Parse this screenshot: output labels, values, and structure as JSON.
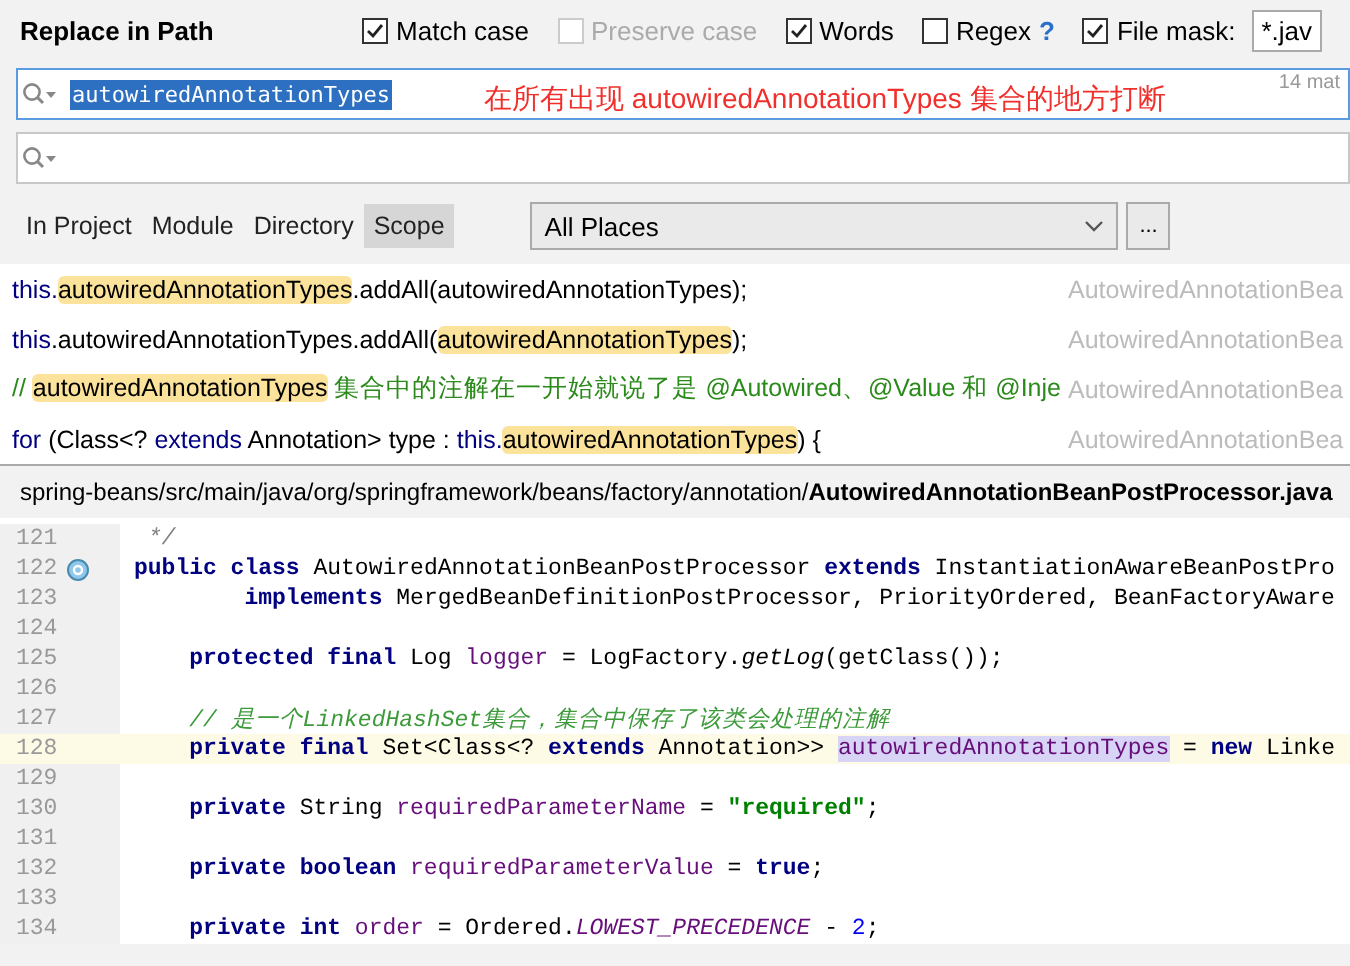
{
  "window": {
    "title": "Replace in Path"
  },
  "options": [
    {
      "label": "Match case",
      "checked": true,
      "disabled": false
    },
    {
      "label": "Preserve case",
      "checked": false,
      "disabled": true
    },
    {
      "label": "Words",
      "checked": true,
      "disabled": false
    },
    {
      "label": "Regex",
      "checked": false,
      "disabled": false,
      "help": "?"
    },
    {
      "label": "File mask:",
      "checked": true,
      "disabled": false,
      "field_value": "*.jav"
    }
  ],
  "search": {
    "value": "autowiredAnnotationTypes",
    "count": "14 mat"
  },
  "annotation": "在所有出现 autowiredAnnotationTypes 集合的地方打断",
  "scope_tabs": [
    {
      "label": "In Project",
      "selected": false
    },
    {
      "label": "Module",
      "selected": false
    },
    {
      "label": "Directory",
      "selected": false
    },
    {
      "label": "Scope",
      "selected": true
    }
  ],
  "scope_dropdown": {
    "value": "All Places"
  },
  "more_button": "...",
  "results": [
    {
      "segments": [
        {
          "kind": "kw",
          "text": "this."
        },
        {
          "kind": "match",
          "text": "autowiredAnnotationTypes"
        },
        {
          "kind": "plain",
          "text": ".addAll(autowiredAnnotationTypes);"
        }
      ],
      "file": "AutowiredAnnotationBea"
    },
    {
      "segments": [
        {
          "kind": "kw",
          "text": "this"
        },
        {
          "kind": "plain",
          "text": ".autowiredAnnotationTypes.addAll("
        },
        {
          "kind": "match",
          "text": "autowiredAnnotationTypes"
        },
        {
          "kind": "plain",
          "text": ");"
        }
      ],
      "file": "AutowiredAnnotationBea"
    },
    {
      "segments": [
        {
          "kind": "comment",
          "text": "// "
        },
        {
          "kind": "match",
          "text": "autowiredAnnotationTypes"
        },
        {
          "kind": "comment",
          "text": " 集合中的注解在一开始就说了是 @Autowired、@Value 和 @Inje"
        }
      ],
      "file": "AutowiredAnnotationBea"
    },
    {
      "segments": [
        {
          "kind": "kw",
          "text": "for"
        },
        {
          "kind": "plain",
          "text": " (Class<? "
        },
        {
          "kind": "kw",
          "text": "extends"
        },
        {
          "kind": "plain",
          "text": " Annotation> type : "
        },
        {
          "kind": "kw",
          "text": "this."
        },
        {
          "kind": "match",
          "text": "autowiredAnnotationTypes"
        },
        {
          "kind": "plain",
          "text": ") {"
        }
      ],
      "file": "AutowiredAnnotationBea"
    }
  ],
  "path": {
    "dir": "spring-beans/src/main/java/org/springframework/beans/factory/annotation/",
    "file": "AutowiredAnnotationBeanPostProcessor.java"
  },
  "code_lines": [
    {
      "number": "121",
      "current": false,
      "marker": false,
      "segments": [
        {
          "kind": "doc",
          "text": " */"
        }
      ]
    },
    {
      "number": "122",
      "current": false,
      "marker": true,
      "segments": [
        {
          "kind": "kw",
          "text": "public class"
        },
        {
          "kind": "plain",
          "text": " AutowiredAnnotationBeanPostProcessor "
        },
        {
          "kind": "kw",
          "text": "extends"
        },
        {
          "kind": "plain",
          "text": " InstantiationAwareBeanPostPro"
        }
      ]
    },
    {
      "number": "123",
      "current": false,
      "marker": false,
      "segments": [
        {
          "kind": "kw",
          "text": "        implements"
        },
        {
          "kind": "plain",
          "text": " MergedBeanDefinitionPostProcessor, PriorityOrdered, BeanFactoryAware"
        }
      ]
    },
    {
      "number": "124",
      "current": false,
      "marker": false
    },
    {
      "number": "125",
      "current": false,
      "marker": false,
      "segments": [
        {
          "kind": "kw",
          "text": "    protected final"
        },
        {
          "kind": "plain",
          "text": " Log "
        },
        {
          "kind": "field",
          "text": "logger"
        },
        {
          "kind": "plain",
          "text": " = LogFactory."
        },
        {
          "kind": "italic",
          "text": "getLog"
        },
        {
          "kind": "plain",
          "text": "(getClass());"
        }
      ]
    },
    {
      "number": "126",
      "current": false,
      "marker": false
    },
    {
      "number": "127",
      "current": false,
      "marker": false,
      "segments": [
        {
          "kind": "comment",
          "text": "    // 是一个LinkedHashSet集合，集合中保存了该类会处理的注解"
        }
      ]
    },
    {
      "number": "128",
      "current": true,
      "marker": false,
      "segments": [
        {
          "kind": "kw",
          "text": "    private final"
        },
        {
          "kind": "plain",
          "text": " Set<Class<? "
        },
        {
          "kind": "kw",
          "text": "extends"
        },
        {
          "kind": "plain",
          "text": " Annotation>> "
        },
        {
          "kind": "usage",
          "text": "autowiredAnnotationTypes"
        },
        {
          "kind": "plain",
          "text": " = "
        },
        {
          "kind": "kw",
          "text": "new"
        },
        {
          "kind": "plain",
          "text": " Linke"
        }
      ]
    },
    {
      "number": "129",
      "current": false,
      "marker": false
    },
    {
      "number": "130",
      "current": false,
      "marker": false,
      "segments": [
        {
          "kind": "kw",
          "text": "    private"
        },
        {
          "kind": "plain",
          "text": " String "
        },
        {
          "kind": "field",
          "text": "requiredParameterName"
        },
        {
          "kind": "plain",
          "text": " = "
        },
        {
          "kind": "str",
          "text": "\"required\""
        },
        {
          "kind": "plain",
          "text": ";"
        }
      ]
    },
    {
      "number": "131",
      "current": false,
      "marker": false
    },
    {
      "number": "132",
      "current": false,
      "marker": false,
      "segments": [
        {
          "kind": "kw",
          "text": "    private boolean "
        },
        {
          "kind": "field",
          "text": "requiredParameterValue"
        },
        {
          "kind": "plain",
          "text": " = "
        },
        {
          "kind": "kw",
          "text": "true"
        },
        {
          "kind": "plain",
          "text": ";"
        }
      ]
    },
    {
      "number": "133",
      "current": false,
      "marker": false
    },
    {
      "number": "134",
      "current": false,
      "marker": false,
      "segments": [
        {
          "kind": "kw",
          "text": "    private int "
        },
        {
          "kind": "field",
          "text": "order"
        },
        {
          "kind": "plain",
          "text": " = Ordered."
        },
        {
          "kind": "const",
          "text": "LOWEST_PRECEDENCE"
        },
        {
          "kind": "plain",
          "text": " - "
        },
        {
          "kind": "num",
          "text": "2"
        },
        {
          "kind": "plain",
          "text": ";"
        }
      ]
    }
  ]
}
